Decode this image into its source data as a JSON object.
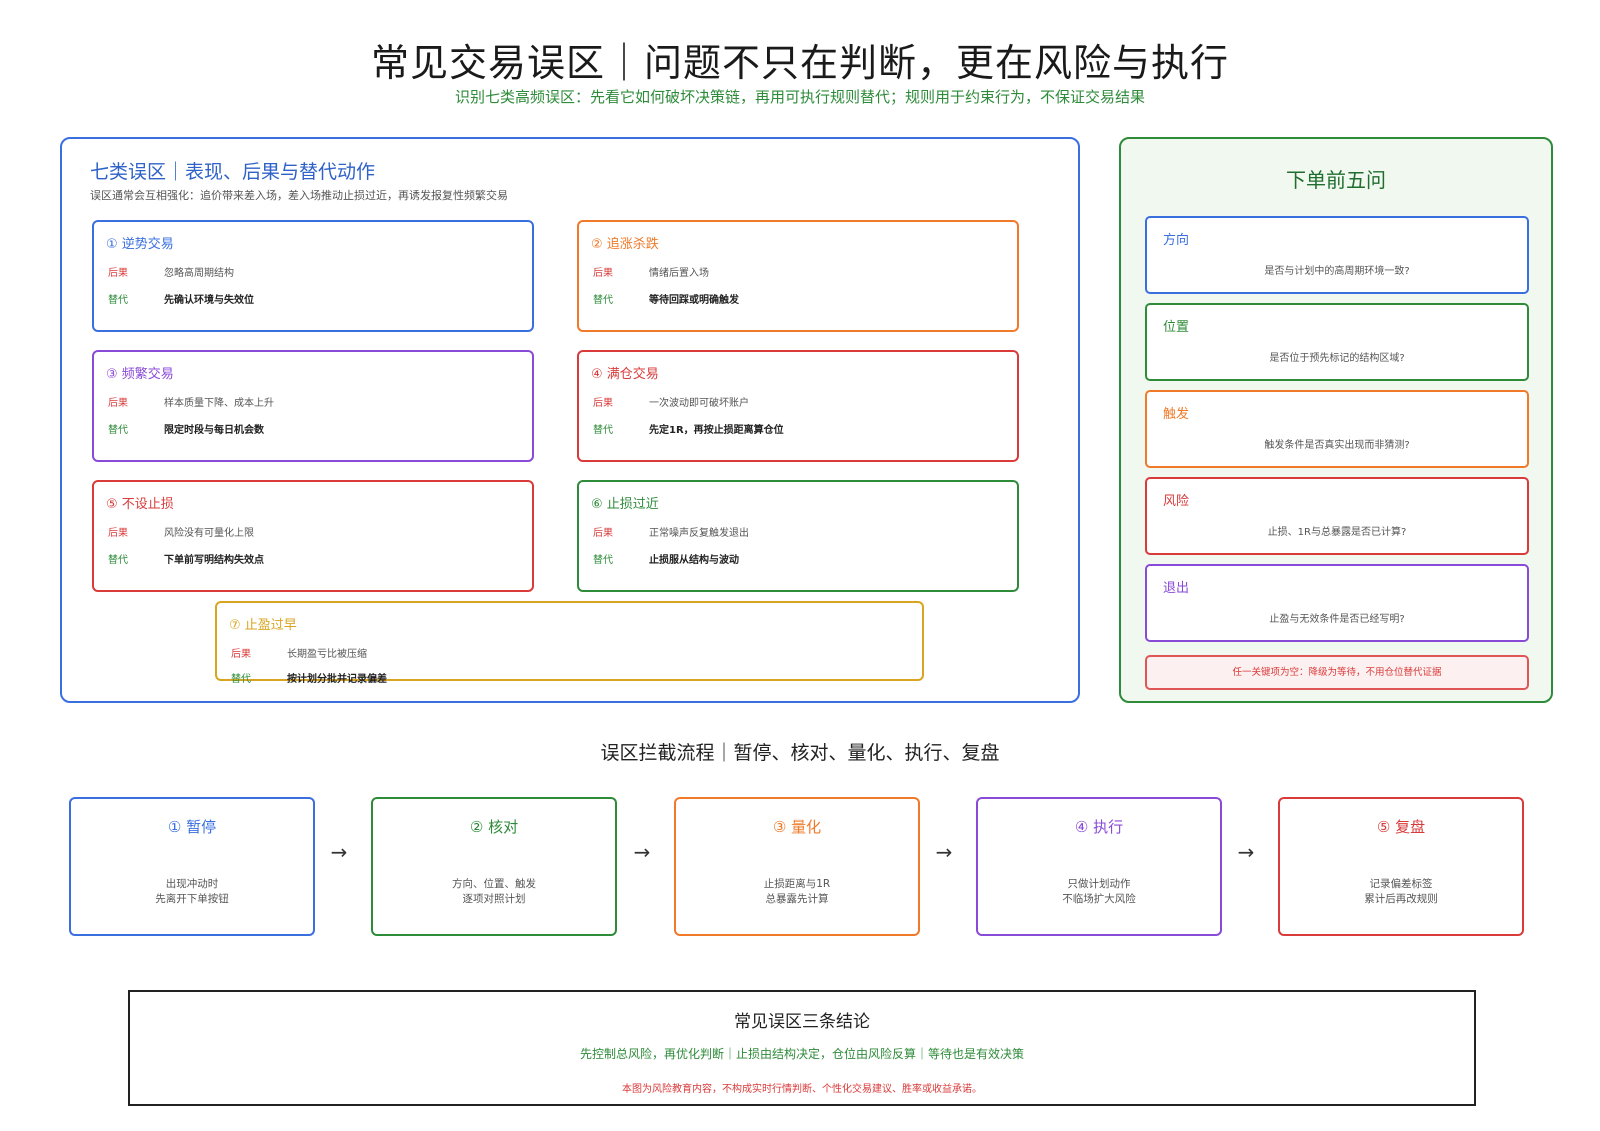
{
  "header": {
    "title": "常见交易误区｜问题不只在判断，更在风险与执行",
    "subtitle": "识别七类高频误区：先看它如何破坏决策链，再用可执行规则替代；规则用于约束行为，不保证交易结果"
  },
  "mistakes": {
    "title": "七类误区｜表现、后果与替代动作",
    "note": "误区通常会互相强化：追价带来差入场，差入场推动止损过近，再诱发报复性频繁交易",
    "consequence_label": "后果",
    "replacement_label": "替代",
    "items": [
      {
        "title": "① 逆势交易",
        "consequence": "忽略高周期结构",
        "replacement": "先确认环境与失效位",
        "color": "#3a6fe0"
      },
      {
        "title": "② 追涨杀跌",
        "consequence": "情绪后置入场",
        "replacement": "等待回踩或明确触发",
        "color": "#f07a2a"
      },
      {
        "title": "③ 频繁交易",
        "consequence": "样本质量下降、成本上升",
        "replacement": "限定时段与每日机会数",
        "color": "#8a4ad8"
      },
      {
        "title": "④ 满仓交易",
        "consequence": "一次波动即可破坏账户",
        "replacement": "先定1R，再按止损距离算仓位",
        "color": "#d93a3a"
      },
      {
        "title": "⑤ 不设止损",
        "consequence": "风险没有可量化上限",
        "replacement": "下单前写明结构失效点",
        "color": "#d93a3a"
      },
      {
        "title": "⑥ 止损过近",
        "consequence": "正常噪声反复触发退出",
        "replacement": "止损服从结构与波动",
        "color": "#2e8b3a"
      },
      {
        "title": "⑦ 止盈过早",
        "consequence": "长期盈亏比被压缩",
        "replacement": "按计划分批并记录偏差",
        "color": "#d9a520"
      }
    ]
  },
  "checklist": {
    "title": "下单前五问",
    "items": [
      {
        "label": "方向",
        "question": "是否与计划中的高周期环境一致?",
        "color": "#3a6fe0"
      },
      {
        "label": "位置",
        "question": "是否位于预先标记的结构区域?",
        "color": "#2e8b3a"
      },
      {
        "label": "触发",
        "question": "触发条件是否真实出现而非猜测?",
        "color": "#f07a2a"
      },
      {
        "label": "风险",
        "question": "止损、1R与总暴露是否已计算?",
        "color": "#d93a3a"
      },
      {
        "label": "退出",
        "question": "止盈与无效条件是否已经写明?",
        "color": "#8a4ad8"
      }
    ],
    "warning": "任一关键项为空：降级为等待，不用仓位替代证据"
  },
  "flow": {
    "title": "误区拦截流程｜暂停、核对、量化、执行、复盘",
    "arrow": "→",
    "steps": [
      {
        "title": "① 暂停",
        "line1": "出现冲动时",
        "line2": "先离开下单按钮",
        "color": "#3a6fe0"
      },
      {
        "title": "② 核对",
        "line1": "方向、位置、触发",
        "line2": "逐项对照计划",
        "color": "#2e8b3a"
      },
      {
        "title": "③ 量化",
        "line1": "止损距离与1R",
        "line2": "总暴露先计算",
        "color": "#f07a2a"
      },
      {
        "title": "④ 执行",
        "line1": "只做计划动作",
        "line2": "不临场扩大风险",
        "color": "#8a4ad8"
      },
      {
        "title": "⑤ 复盘",
        "line1": "记录偏差标签",
        "line2": "累计后再改规则",
        "color": "#d93a3a"
      }
    ]
  },
  "conclusion": {
    "title": "常见误区三条结论",
    "line": "先控制总风险，再优化判断｜止损由结构决定，仓位由风险反算｜等待也是有效决策",
    "disclaimer": "本图为风险教育内容，不构成实时行情判断、个性化交易建议、胜率或收益承诺。"
  }
}
